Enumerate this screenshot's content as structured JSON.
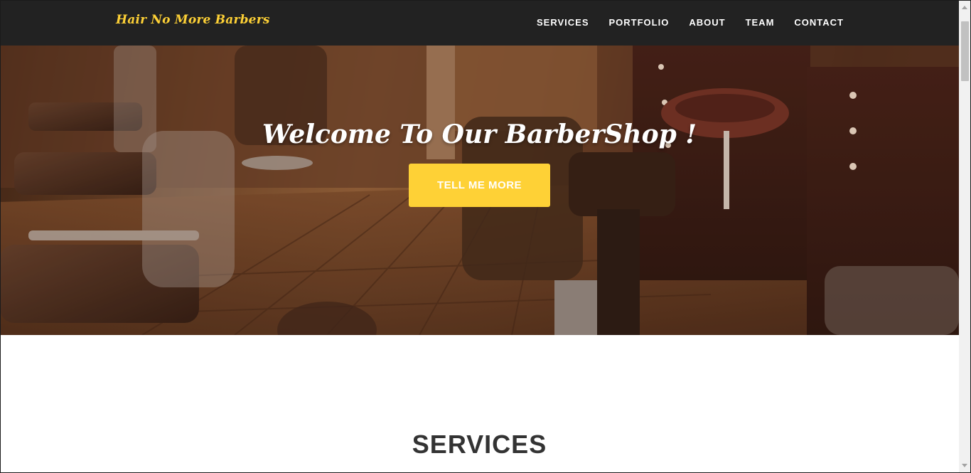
{
  "brand": {
    "name": "Hair No More Barbers"
  },
  "nav": {
    "items": [
      {
        "label": "SERVICES"
      },
      {
        "label": "PORTFOLIO"
      },
      {
        "label": "ABOUT"
      },
      {
        "label": "TEAM"
      },
      {
        "label": "CONTACT"
      }
    ]
  },
  "hero": {
    "heading": "Welcome To Our BarberShop !",
    "button_label": "TELL ME MORE",
    "image": "barbershop-interior"
  },
  "services": {
    "heading": "SERVICES"
  },
  "colors": {
    "navbar_bg": "#222222",
    "accent": "#fed136",
    "heading_text": "#333333"
  }
}
